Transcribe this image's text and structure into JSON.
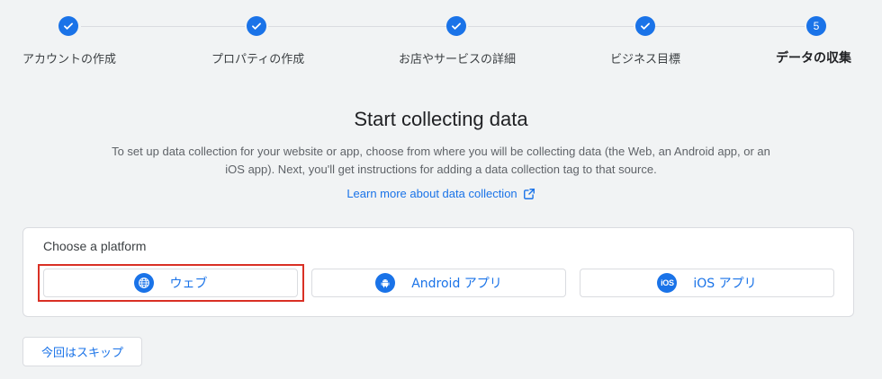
{
  "stepper": {
    "steps": [
      {
        "label": "アカウントの作成",
        "state": "completed"
      },
      {
        "label": "プロパティの作成",
        "state": "completed"
      },
      {
        "label": "お店やサービスの詳細",
        "state": "completed"
      },
      {
        "label": "ビジネス目標",
        "state": "completed"
      },
      {
        "label": "データの収集",
        "state": "active",
        "number": "5"
      }
    ]
  },
  "main": {
    "title": "Start collecting data",
    "description": "To set up data collection for your website or app, choose from where you will be collecting data (the Web, an Android app, or an iOS app). Next, you'll get instructions for adding a data collection tag to that source.",
    "learn_more_link": "Learn more about data collection"
  },
  "platform_card": {
    "title": "Choose a platform",
    "buttons": [
      {
        "label": "ウェブ",
        "icon": "globe-icon",
        "highlighted": true
      },
      {
        "label": "Android アプリ",
        "icon": "android-icon"
      },
      {
        "label": "iOS アプリ",
        "icon": "ios-icon",
        "icon_text": "iOS"
      }
    ]
  },
  "skip_button": {
    "label": "今回はスキップ"
  },
  "colors": {
    "accent": "#1a73e8",
    "background": "#f1f3f4",
    "highlight": "#d93025"
  }
}
